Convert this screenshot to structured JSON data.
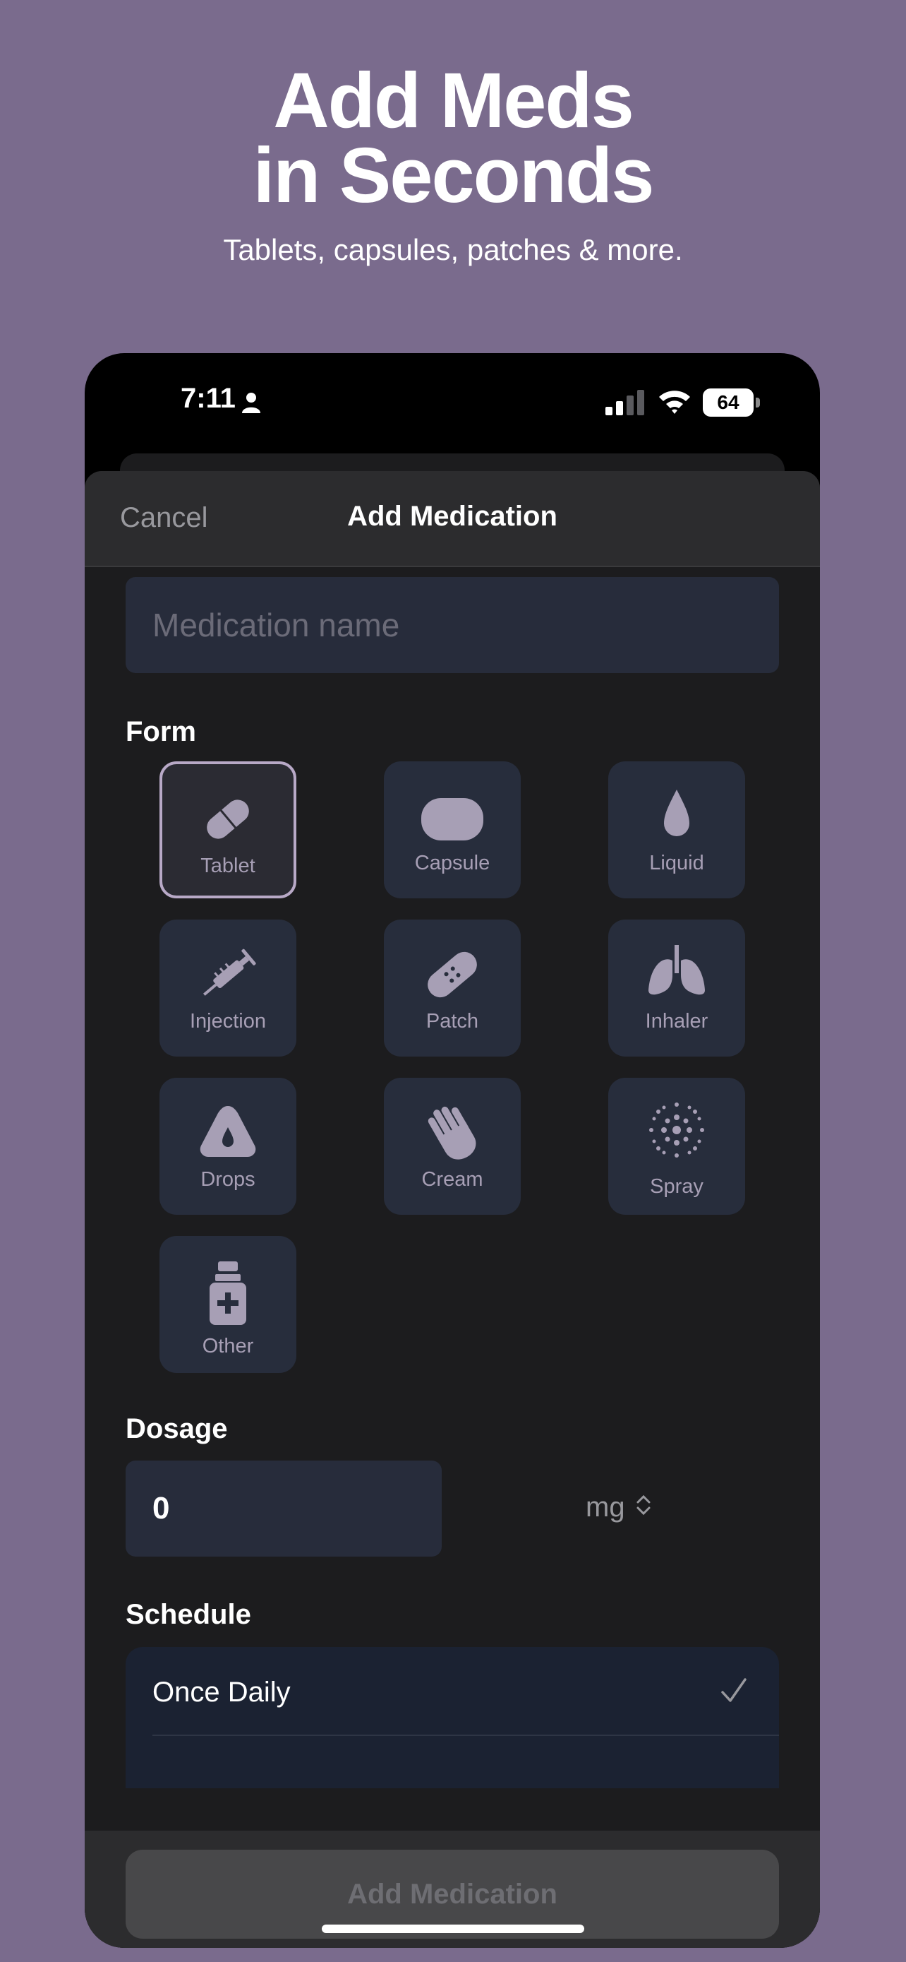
{
  "promo": {
    "headline_line1": "Add Meds",
    "headline_line2": "in Seconds",
    "subhead": "Tablets, capsules, patches & more."
  },
  "status_bar": {
    "time": "7:11",
    "battery": "64"
  },
  "nav": {
    "cancel": "Cancel",
    "title": "Add Medication"
  },
  "name_field": {
    "placeholder": "Medication name",
    "value": ""
  },
  "form": {
    "label": "Form",
    "selected": "Tablet",
    "options": [
      {
        "label": "Tablet",
        "icon": "tablet-icon"
      },
      {
        "label": "Capsule",
        "icon": "capsule-icon"
      },
      {
        "label": "Liquid",
        "icon": "liquid-drop-icon"
      },
      {
        "label": "Injection",
        "icon": "syringe-icon"
      },
      {
        "label": "Patch",
        "icon": "bandage-icon"
      },
      {
        "label": "Inhaler",
        "icon": "lungs-icon"
      },
      {
        "label": "Drops",
        "icon": "drops-icon"
      },
      {
        "label": "Cream",
        "icon": "hand-icon"
      },
      {
        "label": "Spray",
        "icon": "spray-dots-icon"
      },
      {
        "label": "Other",
        "icon": "medicine-bottle-icon"
      }
    ]
  },
  "dosage": {
    "label": "Dosage",
    "value": "0",
    "unit": "mg"
  },
  "schedule": {
    "label": "Schedule",
    "selected_option": "Once Daily"
  },
  "footer": {
    "add_button": "Add Medication"
  },
  "colors": {
    "background": "#7a6b8d",
    "sheet": "#1c1c1e",
    "tile": "#272d3c",
    "selected_border": "#b8a9c7",
    "icon": "#a79fb5"
  }
}
